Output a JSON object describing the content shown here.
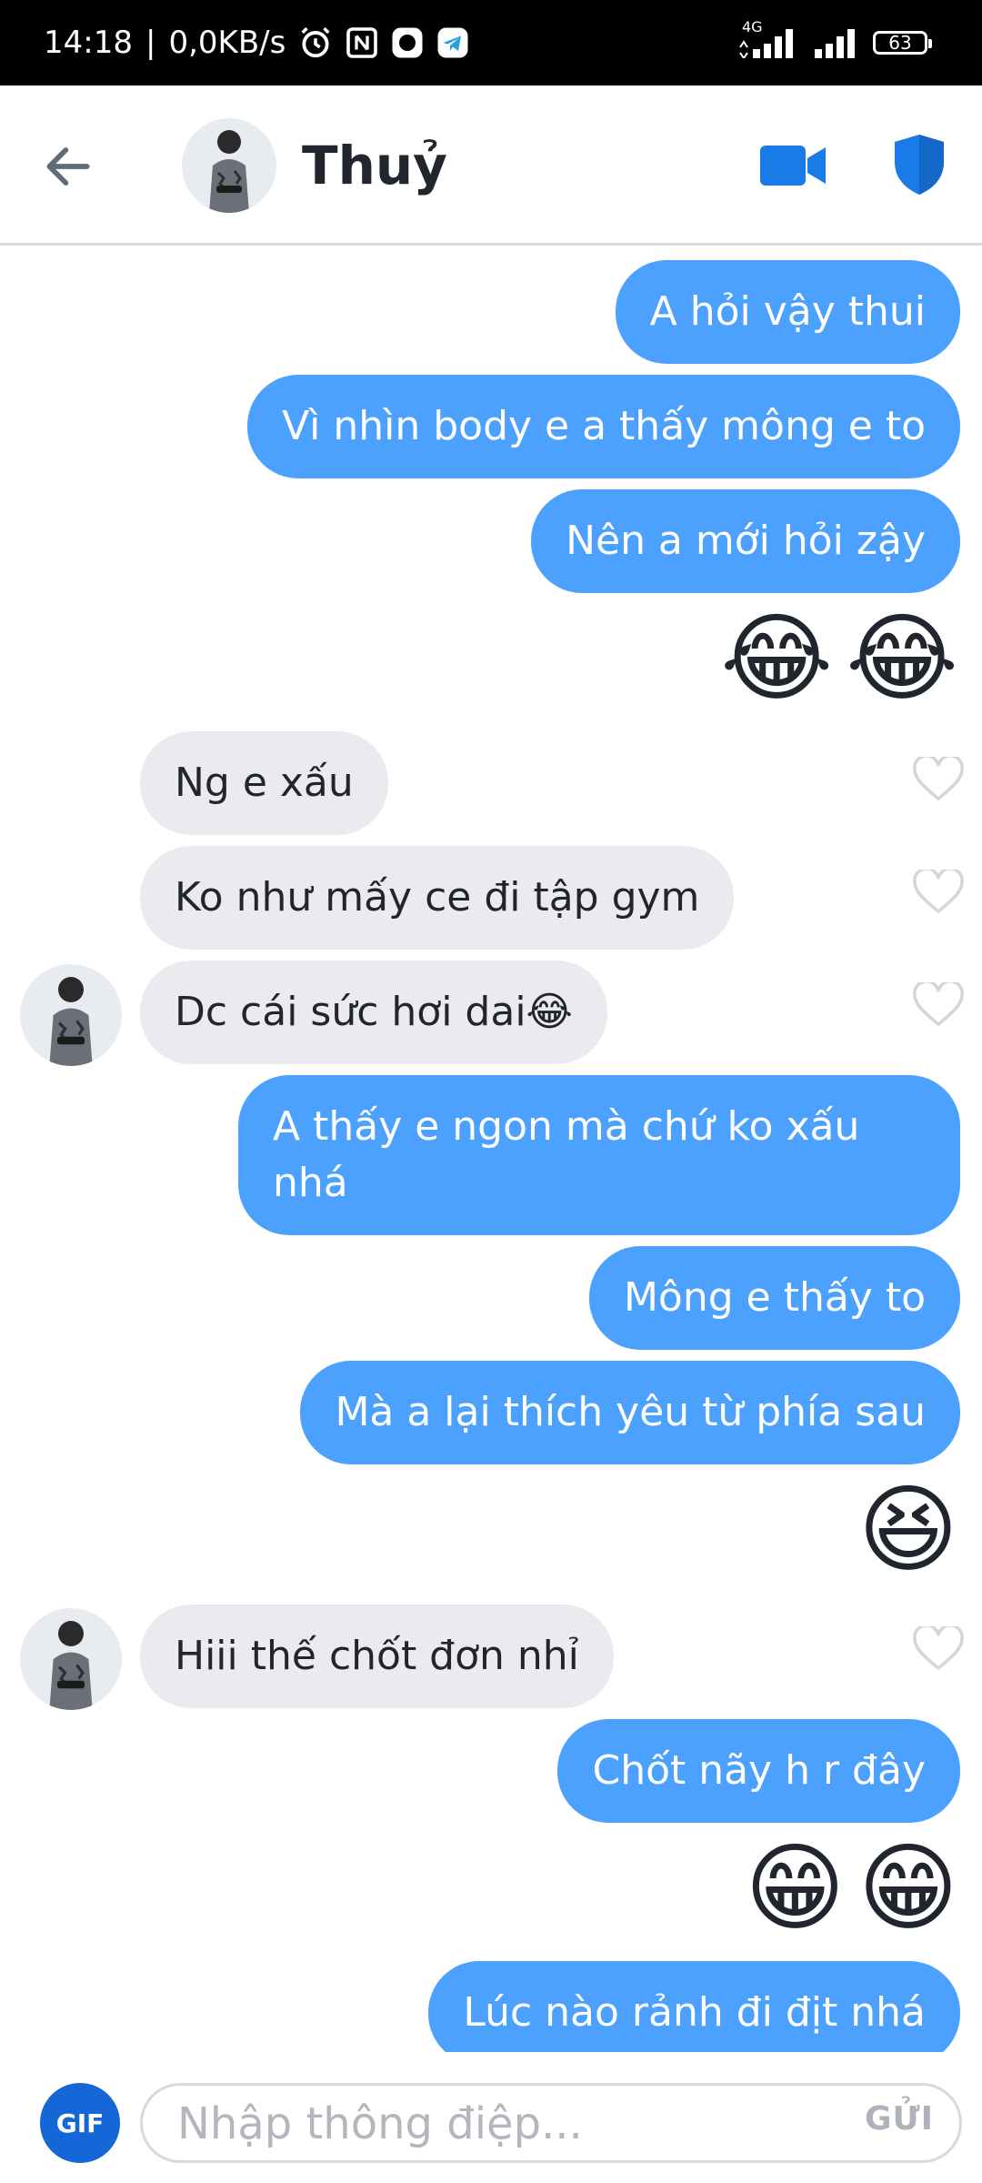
{
  "status_bar": {
    "time": "14:18",
    "separator": "|",
    "speed": "0,0KB/s",
    "network": "4G",
    "battery": "63"
  },
  "header": {
    "contact_name": "Thuỷ"
  },
  "messages": [
    {
      "side": "out",
      "text": "A hỏi vậy thui"
    },
    {
      "side": "out",
      "text": "Vì nhìn body e a thấy mông e to"
    },
    {
      "side": "out",
      "text": "Nên a mới hỏi zậy"
    },
    {
      "side": "out",
      "emoji": [
        "😂",
        "😂"
      ]
    },
    {
      "side": "in",
      "text": "Ng e xấu"
    },
    {
      "side": "in",
      "text": "Ko như mấy ce đi tập gym"
    },
    {
      "side": "in",
      "text": "Dc cái sức hơi dai😂"
    },
    {
      "side": "out",
      "text": "A thấy e ngon mà chứ ko xấu nhá"
    },
    {
      "side": "out",
      "text": "Mông e thấy to"
    },
    {
      "side": "out",
      "text": "Mà a lại thích yêu từ phía sau"
    },
    {
      "side": "out",
      "emoji": [
        "😆"
      ]
    },
    {
      "side": "in",
      "text": "Hiii thế chốt đơn nhỉ"
    },
    {
      "side": "out",
      "text": "Chốt nãy h r đây"
    },
    {
      "side": "out",
      "emoji": [
        "😁",
        "😁"
      ]
    },
    {
      "side": "out",
      "text": "Lúc nào rảnh đi địt nhá"
    }
  ],
  "composer": {
    "gif_label": "GIF",
    "placeholder": "Nhập thông điệp...",
    "send_label": "GỬI"
  },
  "colors": {
    "outgoing_bubble": "#4ca1ff",
    "incoming_bubble": "#ebebef",
    "accent": "#1a7be8"
  }
}
